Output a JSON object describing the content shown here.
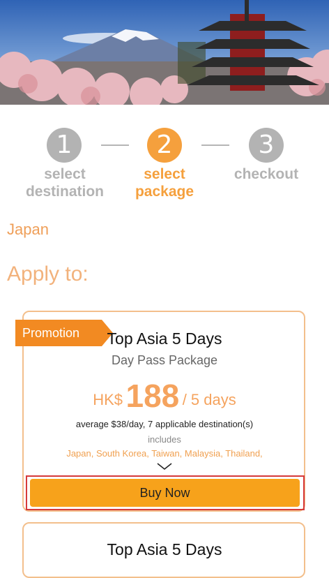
{
  "steps": [
    {
      "number": "1",
      "label_line1": "select",
      "label_line2": "destination",
      "state": "inactive"
    },
    {
      "number": "2",
      "label_line1": "select",
      "label_line2": "package",
      "state": "active"
    },
    {
      "number": "3",
      "label_line1": "checkout",
      "label_line2": "",
      "state": "inactive"
    }
  ],
  "country": "Japan",
  "apply_to_label": "Apply to:",
  "packages": [
    {
      "badge": "Promotion",
      "title": "Top Asia 5 Days",
      "subtitle": "Day Pass Package",
      "currency": "HK$",
      "price": "188",
      "per": "/ 5 days",
      "average": "average $38/day, 7 applicable destination(s)",
      "includes_label": "includes",
      "destinations": "Japan, South Korea, Taiwan, Malaysia, Thailand,",
      "buy_label": "Buy Now"
    },
    {
      "title": "Top Asia 5 Days"
    }
  ],
  "colors": {
    "accent_orange": "#f5a03d",
    "inactive_gray": "#b3b3b3",
    "buy_button": "#f7a21b",
    "promo_badge": "#f28a22"
  }
}
